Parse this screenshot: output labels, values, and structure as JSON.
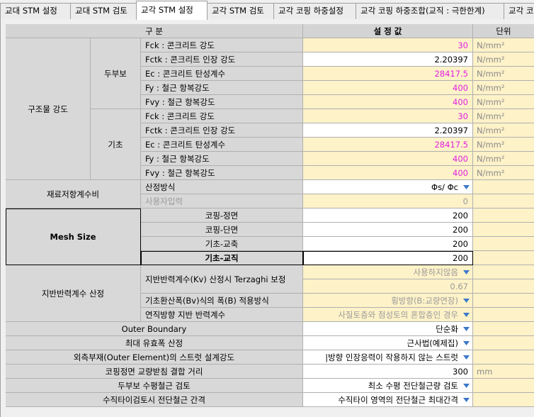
{
  "tabs": [
    {
      "label": "교대 STM 설정",
      "active": false
    },
    {
      "label": "교대 STM 검토",
      "active": false
    },
    {
      "label": "교각 STM 설정",
      "active": true
    },
    {
      "label": "교각 STM 검토",
      "active": false
    },
    {
      "label": "교각 코핑 하중설정",
      "active": false
    },
    {
      "label": "교각 코핑 하중조합(교직 : 극한한계)",
      "active": false
    },
    {
      "label": "교각 코",
      "active": false
    }
  ],
  "header": {
    "item": "구          분",
    "value": "설 정 값",
    "unit": "단위"
  },
  "strength": {
    "group": "구조물 강도",
    "dububo": {
      "label": "두부보",
      "rows": [
        {
          "label": "Fck : 콘크리트 강도",
          "value": "30",
          "unit": "N/mm²"
        },
        {
          "label": "Fctk : 콘크리트 인장 강도",
          "value": "2.20397",
          "unit": "N/mm²"
        },
        {
          "label": "Ec : 콘크리트 탄성계수",
          "value": "28417.5",
          "unit": "N/mm²"
        },
        {
          "label": "Fy : 철근 항복강도",
          "value": "400",
          "unit": "N/mm²"
        },
        {
          "label": "Fvy : 철근 항복강도",
          "value": "400",
          "unit": "N/mm²"
        }
      ]
    },
    "gicho": {
      "label": "기초",
      "rows": [
        {
          "label": "Fck : 콘크리트 강도",
          "value": "30",
          "unit": "N/mm²"
        },
        {
          "label": "Fctk : 콘크리트 인장 강도",
          "value": "2.20397",
          "unit": "N/mm²"
        },
        {
          "label": "Ec : 콘크리트 탄성계수",
          "value": "28417.5",
          "unit": "N/mm²"
        },
        {
          "label": "Fy : 철근 항복강도",
          "value": "400",
          "unit": "N/mm²"
        },
        {
          "label": "Fvy : 철근 항복강도",
          "value": "400",
          "unit": "N/mm²"
        }
      ]
    }
  },
  "resistance": {
    "group": "재료저항계수비",
    "rows": [
      {
        "label": "산정방식",
        "value": "Φs/ Φc"
      },
      {
        "label": "사용자입력",
        "value": "0"
      }
    ]
  },
  "mesh": {
    "group": "Mesh Size",
    "rows": [
      {
        "label": "코핑-정면",
        "value": "200"
      },
      {
        "label": "코핑-단면",
        "value": "200"
      },
      {
        "label": "기초-교축",
        "value": "200"
      },
      {
        "label": "기초-교직",
        "value": "200"
      }
    ]
  },
  "subgrade": {
    "group": "지반반력계수 산정",
    "rows": [
      {
        "label": "지반반력계수(Kv) 산정시 Terzaghi 보정",
        "value": "사용하지않음",
        "value2": "0.67"
      },
      {
        "label": "기초환산폭(Bv)식의 폭(B) 적용방식",
        "value": "횡방향(B:교량연장)"
      },
      {
        "label": "연직방향 지반 반력계수",
        "value": "사질토층와 점성토의 혼합층인 경우"
      }
    ]
  },
  "bottom": [
    {
      "label": "Outer Boundary",
      "value": "단순화",
      "unit": ""
    },
    {
      "label": "최대 유효폭 산정",
      "value": "근사법(예제집)",
      "unit": ""
    },
    {
      "label": "외측부재(Outer Element)의 스트럿 설계강도",
      "value": "|방향 인장응력이 작용하지 않는 스트럿",
      "unit": ""
    },
    {
      "label": "코핑정면 교량받침 결합 거리",
      "value": "300",
      "unit": "mm"
    },
    {
      "label": "두부보 수평철근 검토",
      "value": "최소 수평 전단철근량 검토",
      "unit": ""
    },
    {
      "label": "수직타이검토시 전단철근 간격",
      "value": "수직타이 영역의 전단철근 최대간격",
      "unit": ""
    }
  ],
  "icons": {
    "dropdown": "chevron-down-icon"
  },
  "colors": {
    "input_bg": "#fef2c8",
    "header_bg": "#d4d4d4",
    "magenta": "#e020e0",
    "accent": "#3c78c8"
  }
}
